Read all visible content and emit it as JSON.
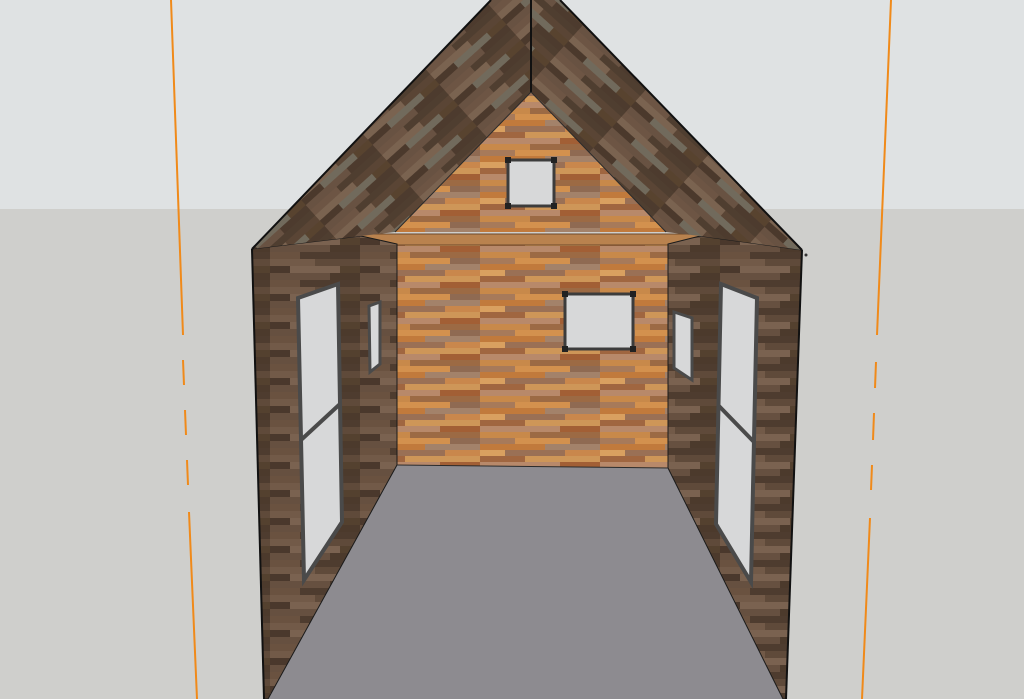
{
  "viewport": {
    "sky_color": "#dfe2e3",
    "ground_color": "#cfcfcc",
    "axis_color": "#f08a1a"
  },
  "model": {
    "floor_color": "#8d8b90",
    "wood_light_base": "#b0733c",
    "wood_dark_base": "#5b4636",
    "window_glass": "#d7d8d9",
    "window_frame": "#3c3c3c"
  }
}
